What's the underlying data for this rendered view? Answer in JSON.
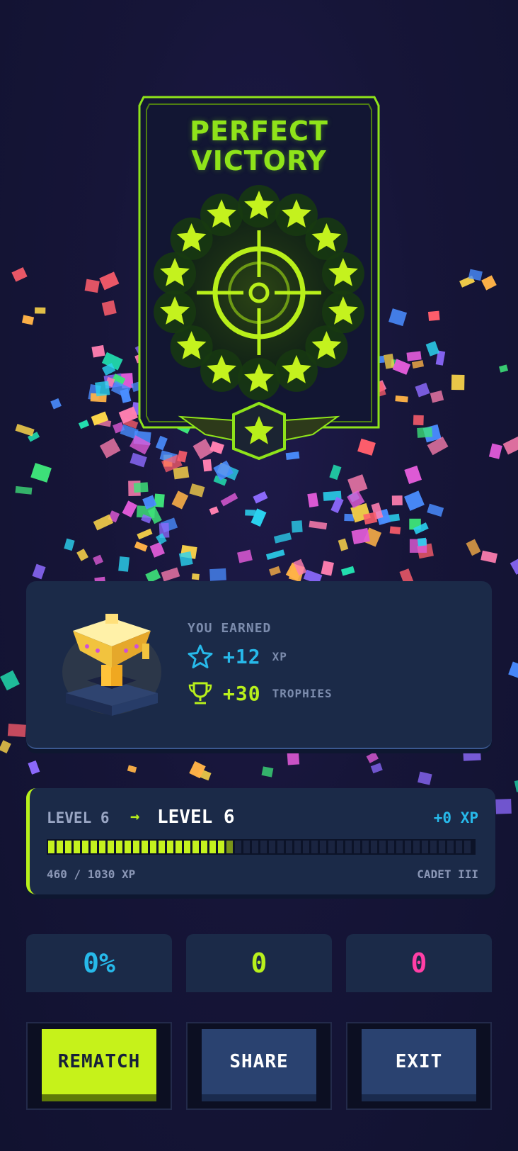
{
  "badge": {
    "title_line1": "PERFECT",
    "title_line2": "VICTORY",
    "accent_color": "#8fe31a"
  },
  "rewards": {
    "label": "YOU EARNED",
    "xp_value": "+12",
    "xp_unit": "XP",
    "xp_icon": "star-outline-icon",
    "trophy_value": "+30",
    "trophy_unit": "TROPHIES",
    "trophy_icon": "trophy-outline-icon",
    "xp_color": "#27b9ea",
    "trophy_color": "#b8f01c"
  },
  "level": {
    "from_label": "LEVEL 6",
    "arrow": "→",
    "to_label": "LEVEL 6",
    "gain": "+0 XP",
    "progress_fraction": 0.447,
    "xp_text": "460 / 1030 XP",
    "rank": "CADET III"
  },
  "stats": [
    {
      "value": "0%",
      "color": "#27b9ea"
    },
    {
      "value": "0",
      "color": "#b8f01c"
    },
    {
      "value": "0",
      "color": "#ff3fa6"
    }
  ],
  "buttons": {
    "rematch": "REMATCH",
    "share": "SHARE",
    "exit": "EXIT"
  }
}
